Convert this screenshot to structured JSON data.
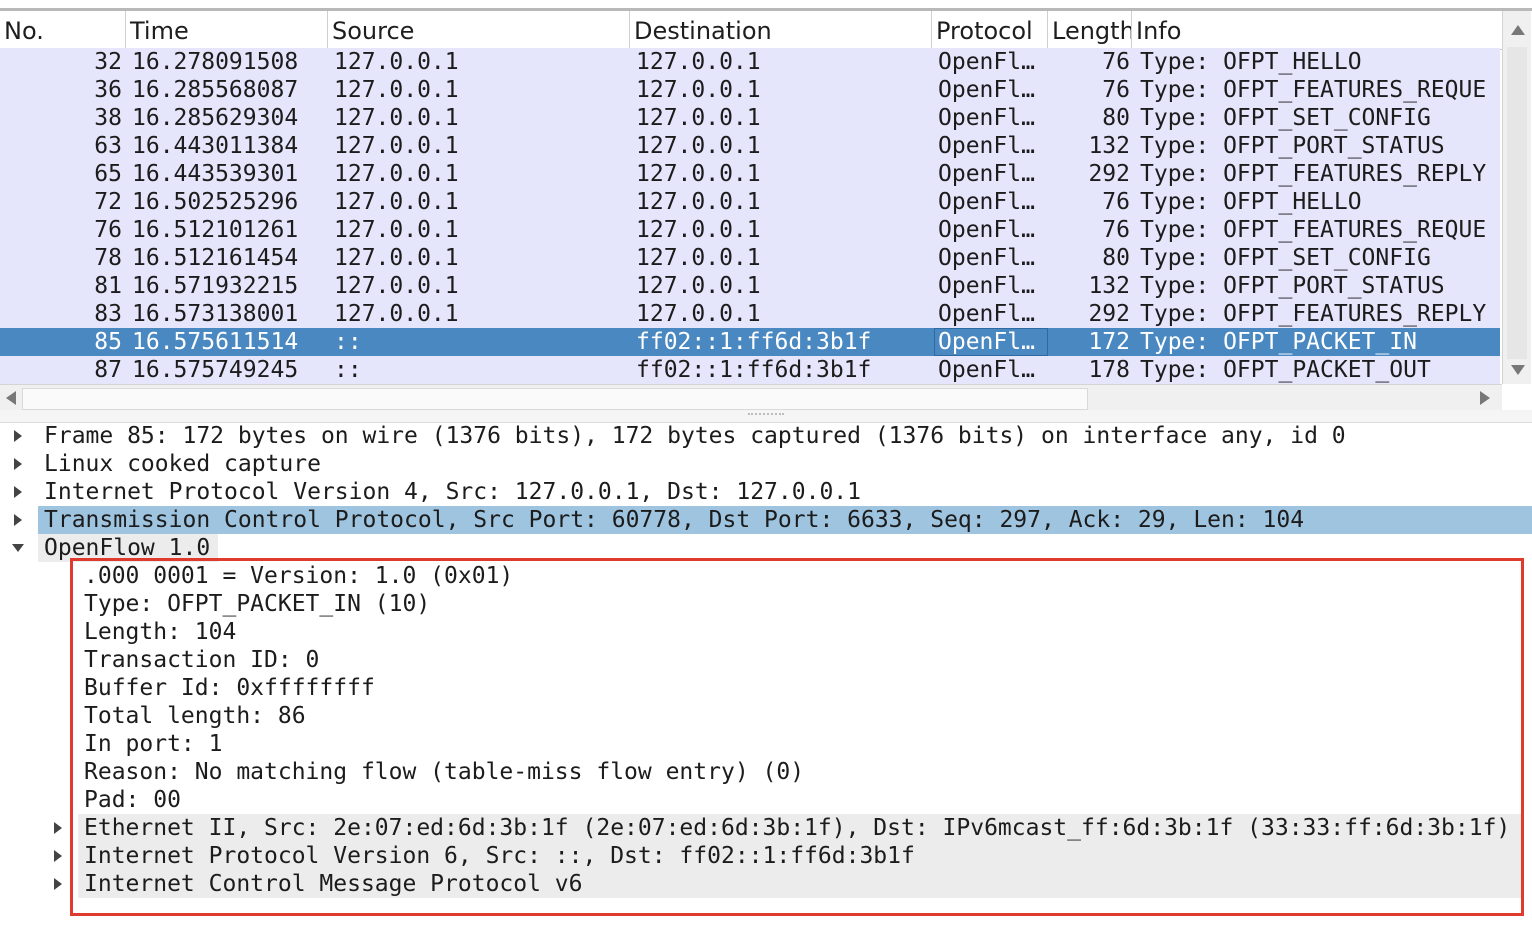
{
  "packet_list": {
    "columns": [
      "No.",
      "Time",
      "Source",
      "Destination",
      "Protocol",
      "Length",
      "Info"
    ],
    "rows": [
      {
        "no": "32",
        "time": "16.278091508",
        "source": "127.0.0.1",
        "destination": "127.0.0.1",
        "protocol": "OpenFl…",
        "length": "76",
        "info": "Type: OFPT_HELLO"
      },
      {
        "no": "36",
        "time": "16.285568087",
        "source": "127.0.0.1",
        "destination": "127.0.0.1",
        "protocol": "OpenFl…",
        "length": "76",
        "info": "Type: OFPT_FEATURES_REQUE"
      },
      {
        "no": "38",
        "time": "16.285629304",
        "source": "127.0.0.1",
        "destination": "127.0.0.1",
        "protocol": "OpenFl…",
        "length": "80",
        "info": "Type: OFPT_SET_CONFIG"
      },
      {
        "no": "63",
        "time": "16.443011384",
        "source": "127.0.0.1",
        "destination": "127.0.0.1",
        "protocol": "OpenFl…",
        "length": "132",
        "info": "Type: OFPT_PORT_STATUS"
      },
      {
        "no": "65",
        "time": "16.443539301",
        "source": "127.0.0.1",
        "destination": "127.0.0.1",
        "protocol": "OpenFl…",
        "length": "292",
        "info": "Type: OFPT_FEATURES_REPLY"
      },
      {
        "no": "72",
        "time": "16.502525296",
        "source": "127.0.0.1",
        "destination": "127.0.0.1",
        "protocol": "OpenFl…",
        "length": "76",
        "info": "Type: OFPT_HELLO"
      },
      {
        "no": "76",
        "time": "16.512101261",
        "source": "127.0.0.1",
        "destination": "127.0.0.1",
        "protocol": "OpenFl…",
        "length": "76",
        "info": "Type: OFPT_FEATURES_REQUE"
      },
      {
        "no": "78",
        "time": "16.512161454",
        "source": "127.0.0.1",
        "destination": "127.0.0.1",
        "protocol": "OpenFl…",
        "length": "80",
        "info": "Type: OFPT_SET_CONFIG"
      },
      {
        "no": "81",
        "time": "16.571932215",
        "source": "127.0.0.1",
        "destination": "127.0.0.1",
        "protocol": "OpenFl…",
        "length": "132",
        "info": "Type: OFPT_PORT_STATUS"
      },
      {
        "no": "83",
        "time": "16.573138001",
        "source": "127.0.0.1",
        "destination": "127.0.0.1",
        "protocol": "OpenFl…",
        "length": "292",
        "info": "Type: OFPT_FEATURES_REPLY"
      },
      {
        "no": "85",
        "time": "16.575611514",
        "source": "::",
        "destination": "ff02::1:ff6d:3b1f",
        "protocol": "OpenFl…",
        "length": "172",
        "info": "Type: OFPT_PACKET_IN"
      },
      {
        "no": "87",
        "time": "16.575749245",
        "source": "::",
        "destination": "ff02::1:ff6d:3b1f",
        "protocol": "OpenFl…",
        "length": "178",
        "info": "Type: OFPT_PACKET_OUT"
      }
    ],
    "selected_row": 10
  },
  "details": {
    "top_level": [
      {
        "label": "Frame 85: 172 bytes on wire (1376 bits), 172 bytes captured (1376 bits) on interface any, id 0",
        "expanded": false
      },
      {
        "label": "Linux cooked capture",
        "expanded": false
      },
      {
        "label": "Internet Protocol Version 4, Src: 127.0.0.1, Dst: 127.0.0.1",
        "expanded": false
      },
      {
        "label": "Transmission Control Protocol, Src Port: 60778, Dst Port: 6633, Seq: 297, Ack: 29, Len: 104",
        "expanded": false,
        "selected": true
      },
      {
        "label": "OpenFlow 1.0",
        "expanded": true
      }
    ],
    "openflow_fields": [
      ".000 0001 = Version: 1.0 (0x01)",
      "Type: OFPT_PACKET_IN (10)",
      "Length: 104",
      "Transaction ID: 0",
      "Buffer Id: 0xffffffff",
      "Total length: 86",
      "In port: 1",
      "Reason: No matching flow (table-miss flow entry) (0)",
      "Pad: 00"
    ],
    "openflow_subtrees": [
      "Ethernet II, Src: 2e:07:ed:6d:3b:1f (2e:07:ed:6d:3b:1f), Dst: IPv6mcast_ff:6d:3b:1f (33:33:ff:6d:3b:1f)",
      "Internet Protocol Version 6, Src: ::, Dst: ff02::1:ff6d:3b1f",
      "Internet Control Message Protocol v6"
    ]
  },
  "colors": {
    "row_bg": "#e5e5fb",
    "selected_row_bg": "#4a88c2",
    "selected_tree_bg": "#9ec4e0",
    "annotation_box": "#e03a2e"
  },
  "icons": [
    "expand-arrow-icon",
    "collapse-arrow-icon",
    "scroll-up-icon",
    "scroll-down-icon",
    "scroll-left-icon",
    "scroll-right-icon"
  ]
}
